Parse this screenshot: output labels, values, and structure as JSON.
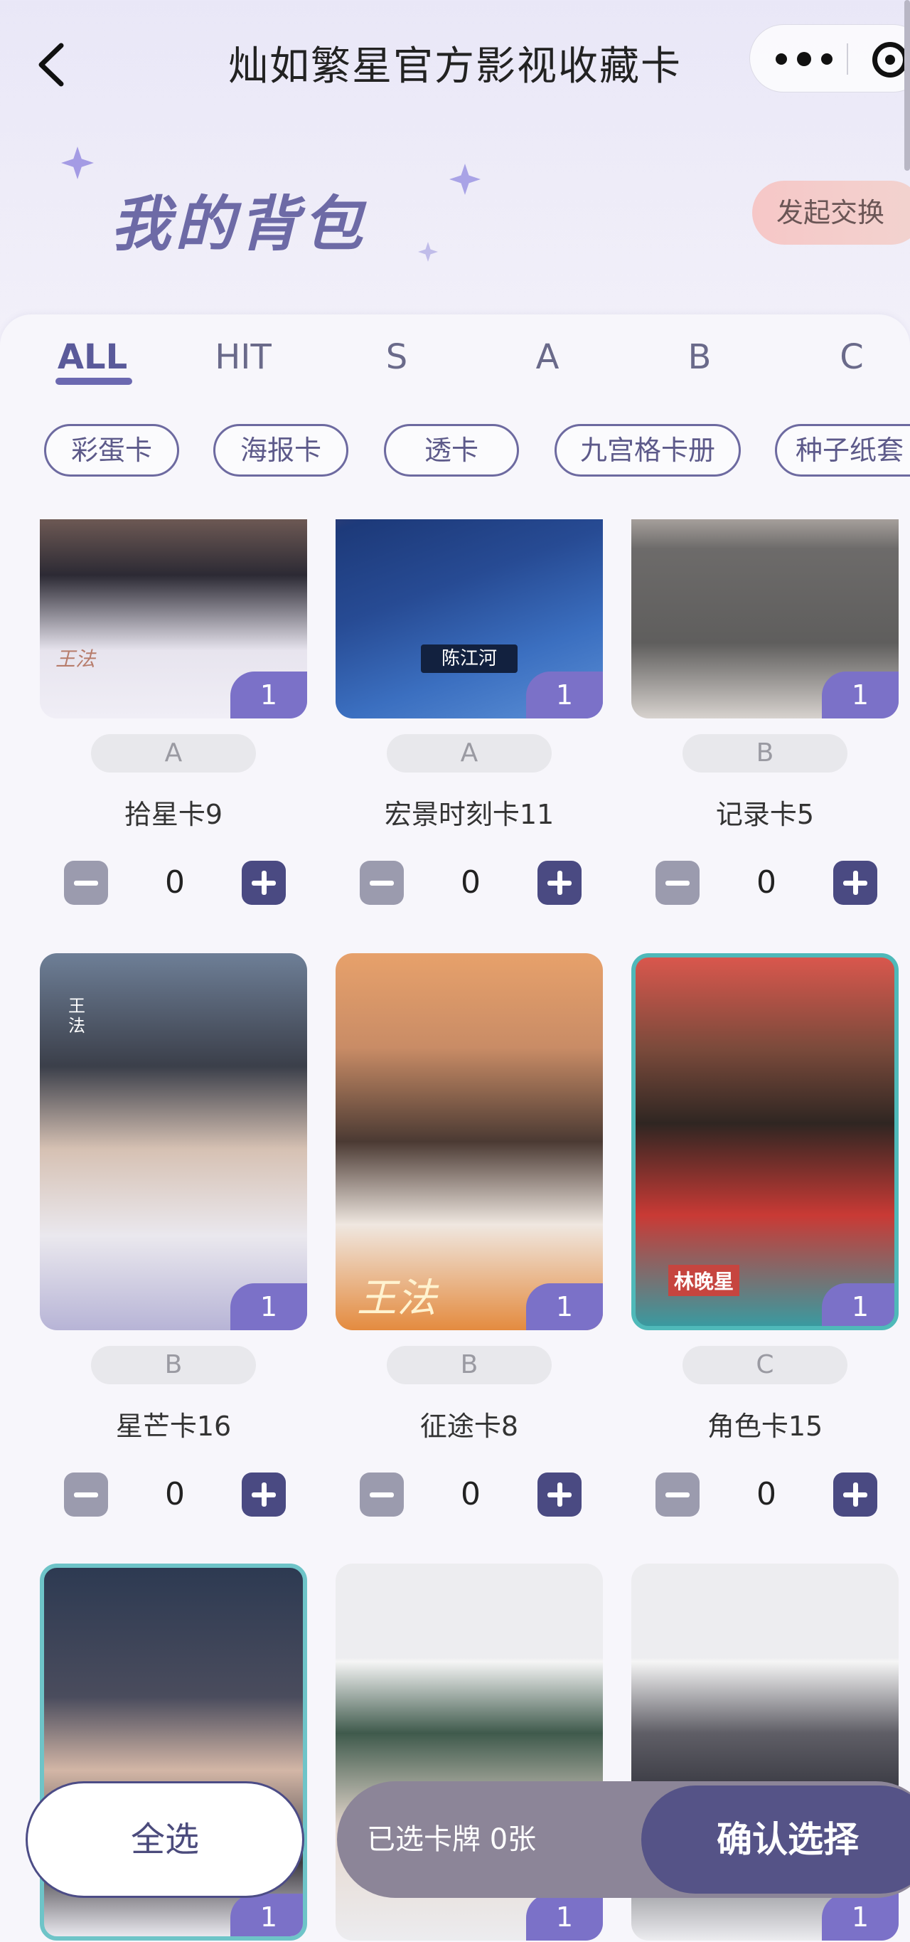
{
  "topbar": {
    "title": "灿如繁星官方影视收藏卡",
    "back_icon": "chevron-left-icon",
    "more_icon": "more-dots-icon",
    "target_icon": "target-icon"
  },
  "header": {
    "title": "我的背包",
    "exchange_button": "发起交换"
  },
  "tabs": [
    "ALL",
    "HIT",
    "S",
    "A",
    "B",
    "C"
  ],
  "active_tab": "ALL",
  "chips": [
    "彩蛋卡",
    "海报卡",
    "透卡",
    "九宫格卡册",
    "种子纸套"
  ],
  "cards": [
    {
      "grade": "A",
      "name": "拾星卡9",
      "count": "1",
      "qty": "0",
      "caption": "王法"
    },
    {
      "grade": "A",
      "name": "宏景时刻卡11",
      "count": "1",
      "qty": "0",
      "caption": "陈江河"
    },
    {
      "grade": "B",
      "name": "记录卡5",
      "count": "1",
      "qty": "0",
      "caption": ""
    },
    {
      "grade": "B",
      "name": "星芒卡16",
      "count": "1",
      "qty": "0",
      "caption": "王法"
    },
    {
      "grade": "B",
      "name": "征途卡8",
      "count": "1",
      "qty": "0",
      "caption": "王法"
    },
    {
      "grade": "C",
      "name": "角色卡15",
      "count": "1",
      "qty": "0",
      "caption": "林晚星"
    },
    {
      "grade": "",
      "name": "",
      "count": "1",
      "qty": "",
      "caption": ""
    },
    {
      "grade": "",
      "name": "",
      "count": "1",
      "qty": "",
      "caption": ""
    },
    {
      "grade": "",
      "name": "",
      "count": "1",
      "qty": "",
      "caption": ""
    }
  ],
  "bottom": {
    "select_all": "全选",
    "selected_text": "已选卡牌 0张",
    "confirm": "确认选择"
  },
  "colors": {
    "accent": "#4a4a82",
    "badge": "#7b71c8",
    "exchange_bg": "#f6c7c7"
  }
}
